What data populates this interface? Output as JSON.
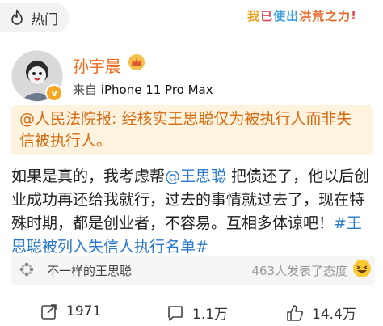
{
  "header": {
    "hot_label": "热门",
    "banner": [
      "我",
      "已",
      "使出",
      "洪荒之力",
      "!"
    ]
  },
  "author": {
    "name": "孙宇晨",
    "source_prefix": "来自",
    "source_device": "iPhone 11 Pro Max"
  },
  "post": {
    "quote": "@人民法院报: 经核实王思聪仅为被执行人而非失信被执行人。",
    "body_pre": "如果是真的，我考虑帮",
    "mention": "@王思聪",
    "body_mid": " 把债还了，他以后创业成功再还给我就行，过去的事情就过去了，现在特殊时期，都是创业者，不容易。互相多体谅吧！",
    "hashtag": "#王思聪被列入失信人执行名单#"
  },
  "topic": {
    "name": "不一样的王思聪",
    "count_text": "463人发表了态度"
  },
  "actions": {
    "repost": "1971",
    "comment": "1.1万",
    "like": "14.4万"
  },
  "colors": {
    "username": "#f06a1e",
    "quote_bg": "#fdf3df",
    "quote_text": "#d76b12",
    "link": "#2a78c8"
  }
}
